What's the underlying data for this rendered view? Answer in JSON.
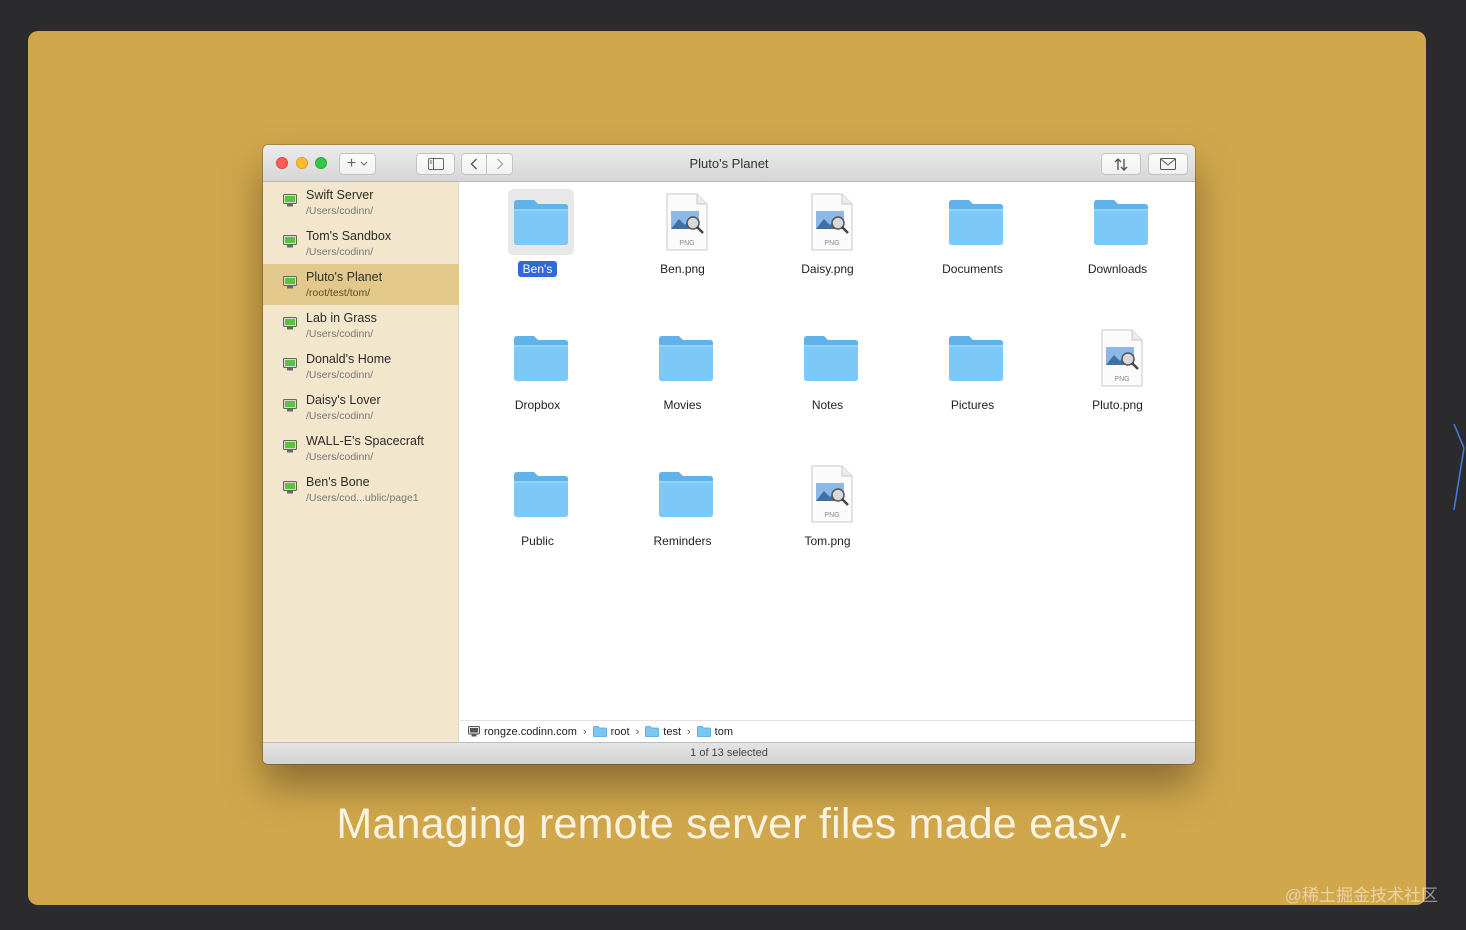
{
  "window": {
    "title": "Pluto's Planet"
  },
  "toolbar": {
    "add_label": "+"
  },
  "sidebar": {
    "servers": [
      {
        "name": "Swift Server",
        "path": "/Users/codinn/"
      },
      {
        "name": "Tom's Sandbox",
        "path": "/Users/codinn/"
      },
      {
        "name": "Pluto's Planet",
        "path": "/root/test/tom/",
        "selected": true
      },
      {
        "name": "Lab in Grass",
        "path": "/Users/codinn/"
      },
      {
        "name": "Donald's Home",
        "path": "/Users/codinn/"
      },
      {
        "name": "Daisy's Lover",
        "path": "/Users/codinn/"
      },
      {
        "name": "WALL-E's Spacecraft",
        "path": "/Users/codinn/"
      },
      {
        "name": "Ben's Bone",
        "path": "/Users/cod...ublic/page1"
      }
    ]
  },
  "files": [
    {
      "name": "Ben's",
      "type": "folder",
      "selected": true
    },
    {
      "name": "Ben.png",
      "type": "png"
    },
    {
      "name": "Daisy.png",
      "type": "png"
    },
    {
      "name": "Documents",
      "type": "folder"
    },
    {
      "name": "Downloads",
      "type": "folder"
    },
    {
      "name": "Dropbox",
      "type": "folder"
    },
    {
      "name": "Movies",
      "type": "folder"
    },
    {
      "name": "Notes",
      "type": "folder"
    },
    {
      "name": "Pictures",
      "type": "folder"
    },
    {
      "name": "Pluto.png",
      "type": "png"
    },
    {
      "name": "Public",
      "type": "folder"
    },
    {
      "name": "Reminders",
      "type": "folder"
    },
    {
      "name": "Tom.png",
      "type": "png"
    }
  ],
  "png_badge": "PNG",
  "pathbar": {
    "host": "rongze.codinn.com",
    "segments": [
      "root",
      "test",
      "tom"
    ],
    "separator": "›"
  },
  "status": {
    "text": "1 of 13 selected"
  },
  "tagline": "Managing remote server files made easy.",
  "watermark": "@稀土掘金技术社区",
  "colors": {
    "background": "#d1a74c",
    "folder": "#6fbff2",
    "selection": "#2f6bd2",
    "sidebar": "#f2e6cc"
  }
}
